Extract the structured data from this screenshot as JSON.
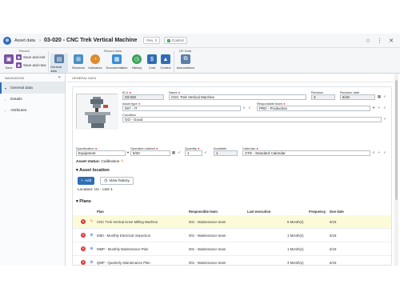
{
  "titlebar": {
    "app_name": "Asset data",
    "title": "03-020 - CNC Trek Vertical Machine",
    "revision": "Rev. 3",
    "status": "Control"
  },
  "ribbon": {
    "groups": [
      "Record",
      "Record data",
      "DE Data"
    ],
    "save": "Save",
    "save_exit": "Save and exit",
    "save_new": "Save and new",
    "general_data": "General data",
    "structure": "Structure",
    "indicators": "Indicators",
    "documentation": "Documentation",
    "history": "History",
    "cost": "Cost",
    "control": "Control",
    "associations": "Associations"
  },
  "nav": {
    "header": "NAVIGATION",
    "items": [
      {
        "label": "General data"
      },
      {
        "label": "Details"
      },
      {
        "label": "Attributes"
      }
    ]
  },
  "main": {
    "section": "GENERAL DATA",
    "id_label": "ID #",
    "id_value": "03-020",
    "name_label": "Name",
    "name_value": "CNC Trek Vertical Machine",
    "revision_label": "Revision",
    "revision_value": "3",
    "revision_date_label": "Revision date",
    "revision_date_value": "6/19",
    "asset_type_label": "Asset type",
    "asset_type_value": "007 - IT",
    "responsible_team_label": "Responsible team",
    "responsible_team_value": "PRD - Production",
    "condition_label": "Condition",
    "condition_value": "GO - Good",
    "specification_label": "Specification",
    "specification_value": "Equipment",
    "operation_started_label": "Operation started",
    "operation_started_value": "8/20",
    "quantity_label": "Quantity",
    "quantity_value": "1",
    "available_label": "Available",
    "available_value": "1",
    "calendar_label": "Calendar",
    "calendar_value": "STD - Standard Calendar",
    "asset_status_label": "Asset status:",
    "asset_status_value": "Calibration",
    "asset_location_title": "Asset location",
    "add_button": "Add",
    "view_history_button": "View history",
    "location_label": "Location:",
    "location_value": "U1 - Unit 1",
    "plans_title": "Plans"
  },
  "plans": {
    "headers": [
      "Plan",
      "Responsible team",
      "Last execution",
      "Frequency",
      "Due date"
    ],
    "rows": [
      {
        "plan": "CNC Trek Vertical Knee Milling Machine",
        "team": "001 - Maintenance team",
        "last": "",
        "freq": "6 Month(s)",
        "due": "6/19",
        "icon": "pencil-icon"
      },
      {
        "plan": "IMEI - Monthly Electrical Inspection",
        "team": "001 - Maintenance team",
        "last": "",
        "freq": "1 Month(s)",
        "due": "6/19",
        "icon": "plan-icon"
      },
      {
        "plan": "MMP - Monthly Maintenance Plan",
        "team": "001 - Maintenance team",
        "last": "",
        "freq": "1 Month(s)",
        "due": "6/19",
        "icon": "plan-icon"
      },
      {
        "plan": "QMP - Quarterly Maintenance Plan",
        "team": "001 - Maintenance team",
        "last": "",
        "freq": "3 Month(s)",
        "due": "6/19",
        "icon": "plan-icon"
      }
    ]
  },
  "colors": {
    "accent": "#2f6db5",
    "highlight_row": "#fcfbd9",
    "delete": "#d23b3b"
  }
}
